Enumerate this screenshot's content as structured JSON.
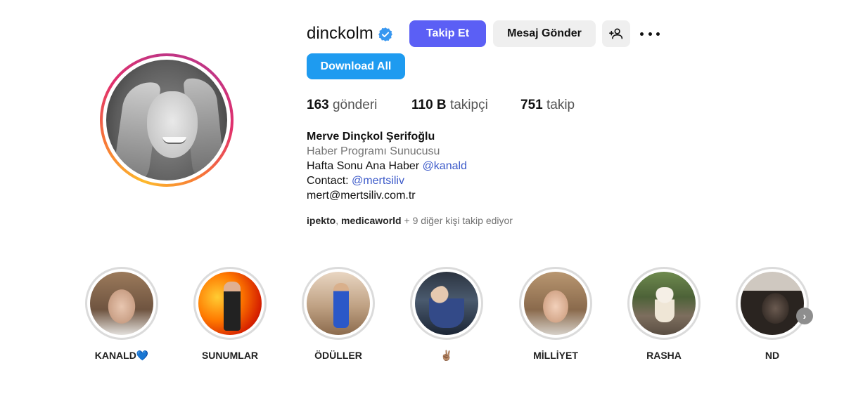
{
  "profile": {
    "username": "dinckolm",
    "verified": true
  },
  "actions": {
    "follow_label": "Takip Et",
    "message_label": "Mesaj Gönder",
    "download_label": "Download All"
  },
  "stats": {
    "posts_count": "163",
    "posts_label": "gönderi",
    "followers_count": "110 B",
    "followers_label": "takipçi",
    "following_count": "751",
    "following_label": "takip"
  },
  "bio": {
    "full_name": "Merve Dinçkol Şerifoğlu",
    "category": "Haber Programı Sunucusu",
    "line1_text": "Hafta Sonu Ana Haber ",
    "line1_link": "@kanald",
    "line2_text": "Contact: ",
    "line2_link": "@mertsiliv",
    "line3_text": "mert@mertsiliv.com.tr"
  },
  "followed_by": {
    "user1": "ipekto",
    "separator": ", ",
    "user2": "medicaworld",
    "suffix": " + 9 diğer kişi takip ediyor"
  },
  "highlights": [
    {
      "label": "KANALD💙"
    },
    {
      "label": "SUNUMLAR"
    },
    {
      "label": "ÖDÜLLER"
    },
    {
      "label": "✌🏽"
    },
    {
      "label": "MİLLİYET"
    },
    {
      "label": "RASHA"
    },
    {
      "label": "ND"
    }
  ],
  "colors": {
    "follow_button": "#5b5ff5",
    "download_button": "#1e9bf0",
    "link": "#3b59c9",
    "verified_badge": "#3897f0"
  },
  "icons": {
    "verified": "verified-badge-icon",
    "add_user": "add-user-icon",
    "more": "more-options-icon",
    "next": "chevron-right-icon"
  }
}
